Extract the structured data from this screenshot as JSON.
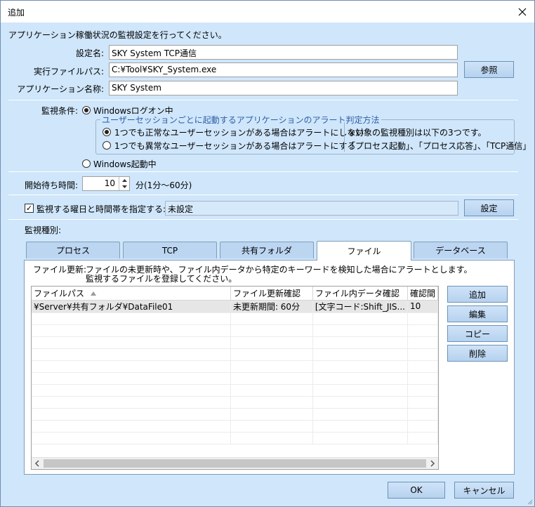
{
  "window": {
    "title": "追加"
  },
  "intro": "アプリケーション稼働状況の監視設定を行ってください。",
  "form": {
    "setting_name_label": "設定名:",
    "setting_name_value": "SKY System TCP通信",
    "exe_path_label": "実行ファイルパス:",
    "exe_path_value": "C:¥Tool¥SKY_System.exe",
    "browse_label": "参照",
    "app_name_label": "アプリケーション名称:",
    "app_name_value": "SKY System"
  },
  "conditions": {
    "label": "監視条件:",
    "logon_label": "Windowsログオン中",
    "group_title": "ユーザーセッションごとに起動するアプリケーションのアラート判定方法",
    "option1": "1つでも正常なユーザーセッションがある場合はアラートにしない",
    "option2": "1つでも異常なユーザーセッションがある場合はアラートにする",
    "note_line1": "※対象の監視種別は以下の3つです。",
    "note_line2": "「プロセス起動」、「プロセス応答」、「TCP通信」",
    "startup_label": "Windows起動中"
  },
  "wait": {
    "label": "開始待ち時間:",
    "value": "10",
    "range": "分(1分～60分)"
  },
  "schedule": {
    "checkbox_label": "監視する曜日と時間帯を指定する:",
    "value": "未設定",
    "button": "設定"
  },
  "monitor": {
    "label": "監視種別:",
    "tabs": [
      "プロセス",
      "TCP",
      "共有フォルダ",
      "ファイル",
      "データベース"
    ],
    "description_prefix": "ファイル更新:",
    "description_line1": "ファイルの未更新時や、ファイル内データから特定のキーワードを検知した場合にアラートとします。",
    "description_line2": "監視するファイルを登録してください。",
    "columns": [
      "ファイルパス",
      "ファイル更新確認",
      "ファイル内データ確認",
      "確認間"
    ],
    "rows": [
      [
        "¥Server¥共有フォルダ¥DataFile01",
        "未更新期間: 60分",
        "[文字コード:Shift_JIS...",
        "10"
      ]
    ],
    "buttons": {
      "add": "追加",
      "edit": "編集",
      "copy": "コピー",
      "delete": "削除"
    }
  },
  "footer": {
    "ok": "OK",
    "cancel": "キャンセル"
  },
  "colors": {
    "background": "#cfe6fb",
    "button": "#b6d2ef",
    "border": "#6c93b7"
  }
}
